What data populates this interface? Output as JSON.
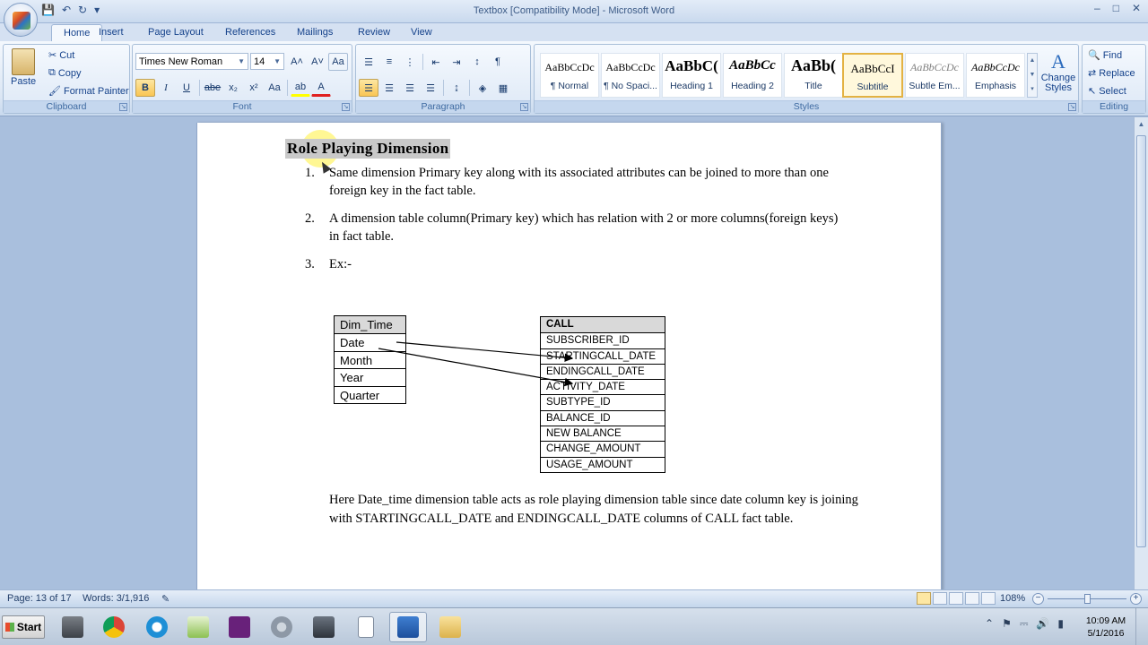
{
  "window": {
    "title": "Textbox [Compatibility Mode] - Microsoft Word",
    "minimize": "–",
    "restore": "□",
    "close": "✕"
  },
  "qat": {
    "save": "💾",
    "undo": "↶",
    "redo": "↻",
    "customize": "▾"
  },
  "tabs": [
    "Home",
    "Insert",
    "Page Layout",
    "References",
    "Mailings",
    "Review",
    "View"
  ],
  "clipboard": {
    "paste": "Paste",
    "cut": "Cut",
    "copy": "Copy",
    "format_painter": "Format Painter",
    "label": "Clipboard"
  },
  "font": {
    "family": "Times New Roman",
    "size": "14",
    "bold": "B",
    "italic": "I",
    "underline": "U",
    "strike": "abe",
    "subscript": "x₂",
    "superscript": "x²",
    "change_case": "Aa",
    "grow": "A˄",
    "shrink": "A˅",
    "clear": "Aa",
    "highlight": "ab",
    "font_color": "A",
    "label": "Font"
  },
  "paragraph": {
    "label": "Paragraph",
    "pilcrow": "¶"
  },
  "styles": {
    "items": [
      {
        "sample": "AaBbCcDc",
        "name": "¶ Normal"
      },
      {
        "sample": "AaBbCcDc",
        "name": "¶ No Spaci..."
      },
      {
        "sample": "AaBbC(",
        "name": "Heading 1"
      },
      {
        "sample": "AaBbCc",
        "name": "Heading 2"
      },
      {
        "sample": "AaBb(",
        "name": "Title"
      },
      {
        "sample": "AaBbCcI",
        "name": "Subtitle"
      },
      {
        "sample": "AaBbCcDc",
        "name": "Subtle Em..."
      },
      {
        "sample": "AaBbCcDc",
        "name": "Emphasis"
      }
    ],
    "change_styles": "Change Styles",
    "label": "Styles"
  },
  "editing": {
    "find": "Find",
    "replace": "Replace",
    "select": "Select",
    "label": "Editing"
  },
  "document": {
    "heading": "Role Playing  Dimension",
    "list": [
      {
        "num": "1.",
        "text": "Same dimension Primary key along with its associated attributes can be joined to more than one foreign key in the fact table."
      },
      {
        "num": "2.",
        "text": "A dimension table column(Primary key) which has relation with 2 or more columns(foreign keys) in fact table."
      },
      {
        "num": "3.",
        "text": "Ex:-"
      }
    ],
    "dim_table": {
      "header": "Dim_Time",
      "rows": [
        "Date",
        "Month",
        "Year",
        "Quarter"
      ]
    },
    "fact_table": {
      "header": "CALL",
      "rows": [
        "SUBSCRIBER_ID",
        "STARTINGCALL_DATE",
        "ENDINGCALL_DATE",
        "ACTIVITY_DATE",
        "SUBTYPE_ID",
        "BALANCE_ID",
        "NEW BALANCE",
        "CHANGE_AMOUNT",
        "USAGE_AMOUNT"
      ]
    },
    "paragraph": "Here Date_time dimension table  acts as role playing dimension table since date column key is joining with STARTINGCALL_DATE  and ENDINGCALL_DATE  columns of CALL  fact table."
  },
  "status": {
    "page": "Page: 13 of 17",
    "words": "Words: 3/1,916",
    "zoom": "108%"
  },
  "taskbar": {
    "start": "Start",
    "time": "10:09 AM",
    "date": "5/1/2016"
  },
  "colors": {
    "accent": "#15428b",
    "ribbon": "#dbe6f4",
    "doc_bg": "#a9bfdd",
    "highlight": "#c9c9c9"
  }
}
